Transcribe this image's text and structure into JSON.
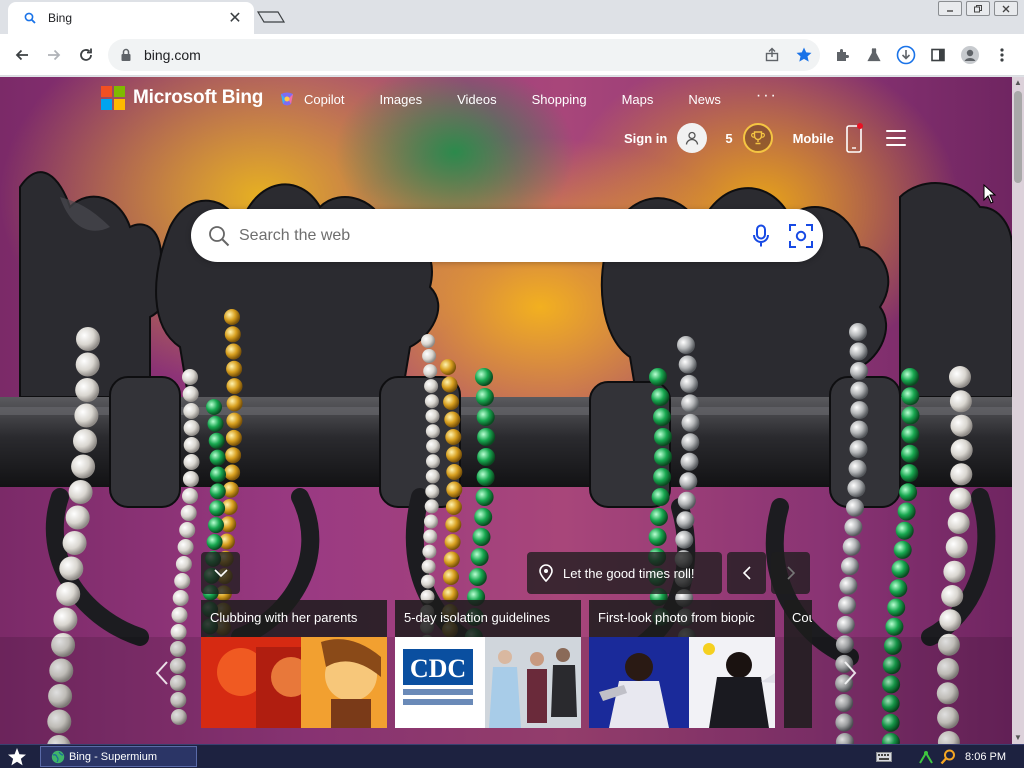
{
  "browser": {
    "tab_title": "Bing",
    "url": "bing.com",
    "close_glyph": "✕"
  },
  "bing": {
    "brand": "Microsoft Bing",
    "nav": {
      "copilot": "Copilot",
      "images": "Images",
      "videos": "Videos",
      "shopping": "Shopping",
      "maps": "Maps",
      "news": "News",
      "more": "···"
    },
    "signin": "Sign in",
    "points": "5",
    "mobile": "Mobile",
    "search_placeholder": "Search the web",
    "caption": "Let the good times roll!",
    "cards": [
      {
        "title": "Clubbing with her parents"
      },
      {
        "title": "5-day isolation guidelines"
      },
      {
        "title": "First-look photo from biopic"
      },
      {
        "title": "Cou"
      }
    ],
    "cdc_text": "CDC"
  },
  "taskbar": {
    "task_label": "Bing - Supermium",
    "clock": "8:06 PM"
  },
  "colors": {
    "ms_red": "#f25022",
    "ms_green": "#7fba00",
    "ms_blue": "#00a4ef",
    "ms_yellow": "#ffb900",
    "star_blue": "#1a73e8"
  }
}
